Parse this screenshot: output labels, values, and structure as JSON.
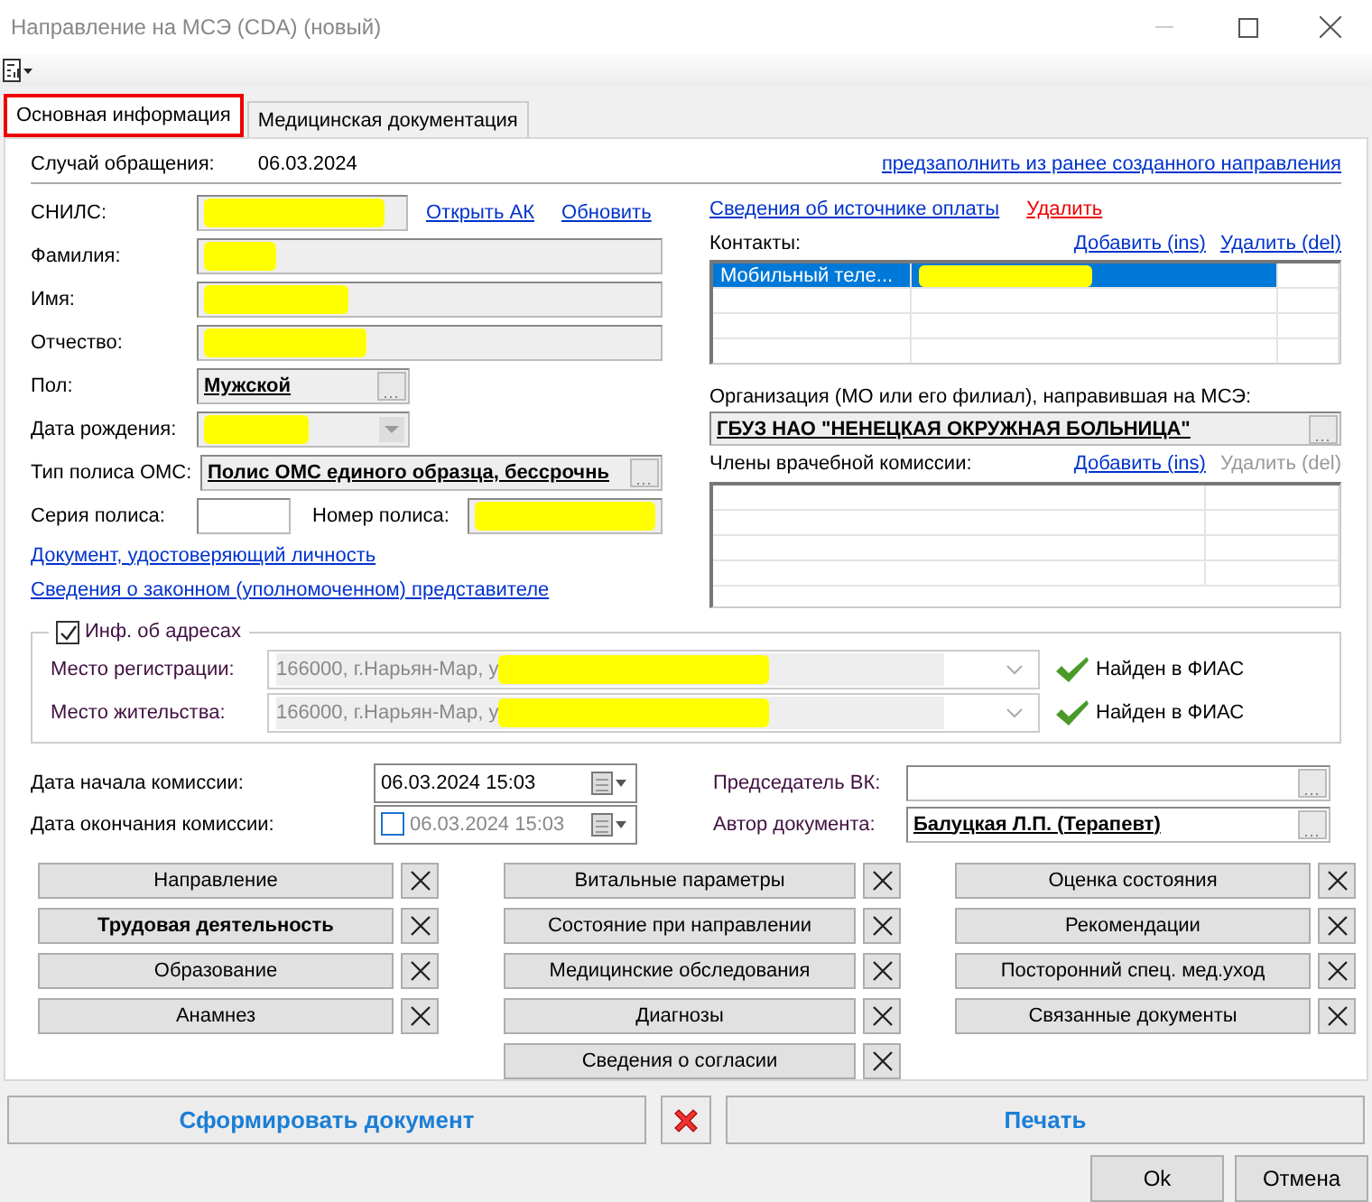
{
  "window": {
    "title": "Направление на МСЭ (CDA) (новый)"
  },
  "tabs": [
    {
      "label": "Основная информация",
      "selected": true
    },
    {
      "label": "Медицинская документация",
      "selected": false
    }
  ],
  "case": {
    "label": "Случай обращения:",
    "value": "06.03.2024"
  },
  "prefill_link": "предзаполнить из ранее созданного направления",
  "snils": {
    "label": "СНИЛС:",
    "redacted": true,
    "links": [
      "Открыть АК",
      "Обновить"
    ]
  },
  "person_fields": [
    {
      "label": "Фамилия:",
      "redacted": true
    },
    {
      "label": "Имя:",
      "redacted": true
    },
    {
      "label": "Отчество:",
      "redacted": true
    }
  ],
  "gender": {
    "label": "Пол:",
    "value": "Мужской"
  },
  "birth_date": {
    "label": "Дата рождения:",
    "redacted": true
  },
  "policy_type": {
    "label": "Тип полиса ОМС:",
    "value": "Полис ОМС единого образца, бессрочнь"
  },
  "policy_series": {
    "label": "Серия полиса:"
  },
  "policy_number": {
    "label": "Номер полиса:",
    "redacted": true
  },
  "links": [
    "Документ, удостоверяющий личность",
    "Сведения о законном (уполномоченном) представителе"
  ],
  "payment": {
    "link": "Сведения об источнике оплаты",
    "delete": "Удалить"
  },
  "contacts": {
    "label": "Контакты:",
    "add": "Добавить (ins)",
    "remove": "Удалить (del)",
    "remove_disabled": false,
    "rows": [
      {
        "type": "Мобильный теле...",
        "value_redacted": true,
        "selected": true
      }
    ]
  },
  "organization": {
    "label": "Организация (МО или его филиал), направившая на МСЭ:",
    "value": "ГБУЗ НАО \"НЕНЕЦКАЯ ОКРУЖНАЯ БОЛЬНИЦА\""
  },
  "commission": {
    "label": "Члены врачебной комиссии:",
    "add": "Добавить (ins)",
    "remove": "Удалить (del)",
    "remove_disabled": true
  },
  "addresses": {
    "label": "Инф. об адресах",
    "checked": true,
    "rows": [
      {
        "label": "Место регистрации:",
        "value": "166000, г.Нарьян-Мар, у",
        "redacted": true,
        "status": "Найден в ФИАС"
      },
      {
        "label": "Место жительства:",
        "value": "166000, г.Нарьян-Мар, у",
        "redacted": true,
        "status": "Найден в ФИАС"
      }
    ]
  },
  "dates": [
    {
      "label": "Дата начала комиссии:",
      "value": "06.03.2024 15:03",
      "kind": "plain",
      "checked": true
    },
    {
      "label": "Дата окончания комиссии:",
      "value": "06.03.2024 15:03",
      "kind": "checkbox",
      "checked": false
    }
  ],
  "chairman": {
    "label": "Председатель ВК:"
  },
  "author": {
    "label": "Автор документа:",
    "value": "Балуцкая Л.П. (Терапевт)"
  },
  "sections": [
    [
      {
        "label": "Направление",
        "bold": false
      },
      {
        "label": "Трудовая деятельность",
        "bold": true
      },
      {
        "label": "Образование",
        "bold": false
      },
      {
        "label": "Анамнез",
        "bold": false
      }
    ],
    [
      {
        "label": "Витальные параметры",
        "bold": false
      },
      {
        "label": "Состояние при направлении",
        "bold": false
      },
      {
        "label": "Медицинские обследования",
        "bold": false
      },
      {
        "label": "Диагнозы",
        "bold": false
      },
      {
        "label": "Сведения о согласии",
        "bold": false
      }
    ],
    [
      {
        "label": "Оценка состояния",
        "bold": false
      },
      {
        "label": "Рекомендации",
        "bold": false
      },
      {
        "label": "Посторонний спец. мед.уход",
        "bold": false
      },
      {
        "label": "Связанные документы",
        "bold": false
      }
    ]
  ],
  "actions": {
    "generate": "Сформировать документ",
    "print": "Печать"
  },
  "dialog_buttons": [
    "Ok",
    "Отмена"
  ]
}
